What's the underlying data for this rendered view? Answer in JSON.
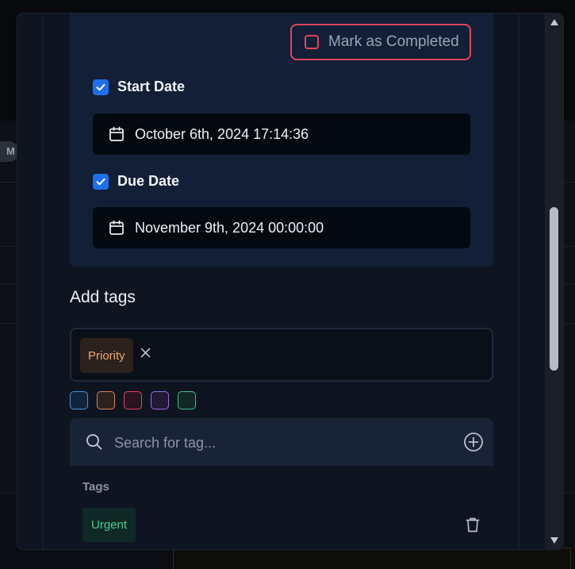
{
  "dates": {
    "mark_completed_label": "Mark as Completed",
    "start_date": {
      "label": "Start Date",
      "checked": true,
      "value": "October 6th, 2024 17:14:36"
    },
    "due_date": {
      "label": "Due Date",
      "checked": true,
      "value": "November 9th, 2024 00:00:00"
    }
  },
  "tags": {
    "heading": "Add tags",
    "selected": [
      {
        "label": "Priority",
        "color": "#f0a872"
      }
    ],
    "swatches": [
      {
        "name": "blue",
        "color": "#4d8fd6"
      },
      {
        "name": "orange",
        "color": "#d9895a"
      },
      {
        "name": "red",
        "color": "#e0455e"
      },
      {
        "name": "purple",
        "color": "#9b6ae0"
      },
      {
        "name": "green",
        "color": "#3fbf86"
      }
    ],
    "search_placeholder": "Search for tag...",
    "list_heading": "Tags",
    "list": [
      {
        "label": "Urgent",
        "color": "#44c98e"
      }
    ]
  },
  "icons": {
    "calendar": "calendar-icon",
    "check": "check-icon",
    "search": "search-icon",
    "add": "plus-circle-icon",
    "remove": "close-icon",
    "delete": "trash-icon"
  }
}
